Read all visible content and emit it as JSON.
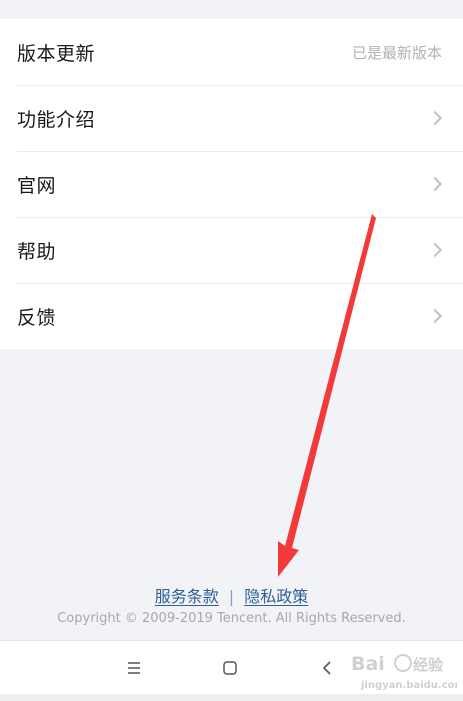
{
  "menu": {
    "items": [
      {
        "label": "版本更新",
        "value": "已是最新版本"
      },
      {
        "label": "功能介绍"
      },
      {
        "label": "官网"
      },
      {
        "label": "帮助"
      },
      {
        "label": "反馈"
      }
    ]
  },
  "footer": {
    "terms_label": "服务条款",
    "separator": "|",
    "privacy_label": "隐私政策",
    "copyright": "Copyright © 2009-2019 Tencent. All Rights Reserved."
  },
  "nav_icons": [
    "menu-icon",
    "home-icon",
    "back-icon"
  ],
  "annotation": {
    "arrow_color": "#f23a3a"
  },
  "colors": {
    "link": "#2e5f97",
    "background": "#f2f3f7"
  }
}
